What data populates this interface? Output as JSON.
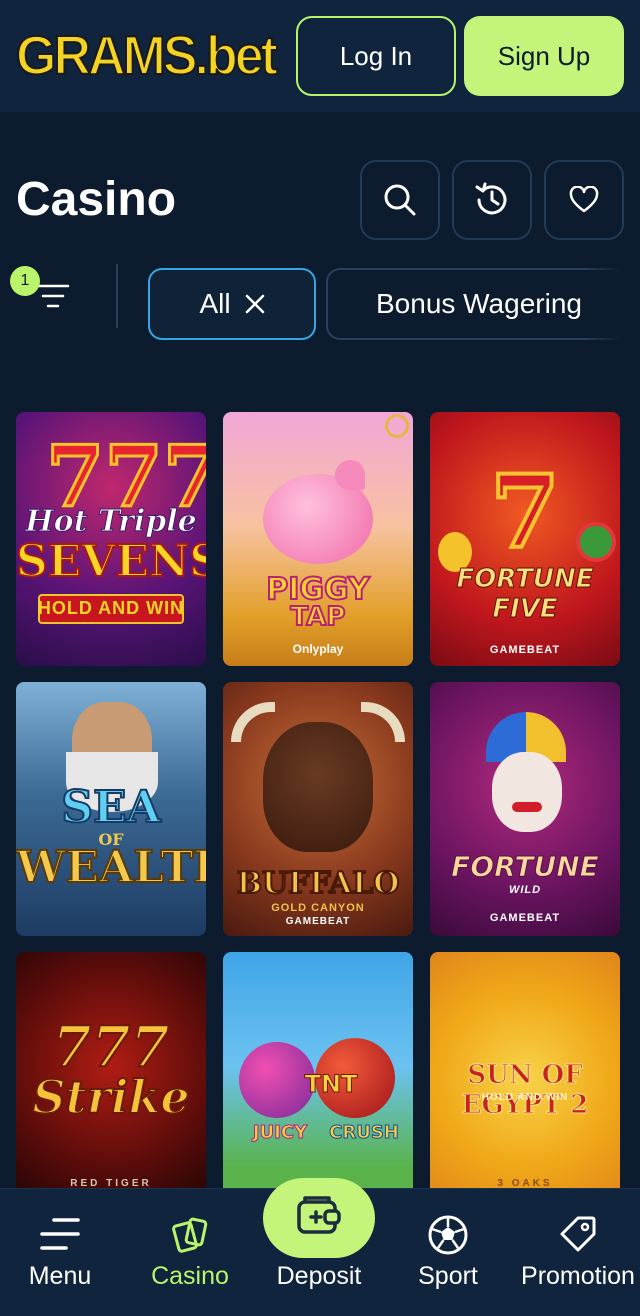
{
  "header": {
    "logo_text": "GRAMS.bet",
    "login_label": "Log In",
    "signup_label": "Sign Up"
  },
  "page": {
    "title": "Casino"
  },
  "filters": {
    "badge_count": "1",
    "chips": [
      {
        "label": "All",
        "active": true
      },
      {
        "label": "Bonus Wagering",
        "active": false
      }
    ]
  },
  "games": [
    {
      "title_line1": "Hot Triple",
      "title_line2": "SEVENS",
      "subtitle": "HOLD AND WIN",
      "provider": ""
    },
    {
      "title_line1": "PIGGY",
      "title_line2": "TAP",
      "subtitle": "",
      "provider": "Onlyplay"
    },
    {
      "title_line1": "FORTUNE",
      "title_line2": "FIVE",
      "subtitle": "",
      "provider": "GAMEBEAT"
    },
    {
      "title_line1": "SEA",
      "title_line2": "WEALTH",
      "subtitle": "OF",
      "provider": ""
    },
    {
      "title_line1": "BUFFALO",
      "title_line2": "",
      "subtitle": "GOLD CANYON",
      "provider": "GAMEBEAT"
    },
    {
      "title_line1": "FORTUNE",
      "title_line2": "WILD",
      "subtitle": "",
      "provider": "GAMEBEAT"
    },
    {
      "title_line1": "777",
      "title_line2": "Strike",
      "subtitle": "",
      "provider": "RED TIGER"
    },
    {
      "title_line1": "JUICY",
      "title_line2": "CRUSH",
      "subtitle": "TNT",
      "provider": ""
    },
    {
      "title_line1": "SUN OF EGYPT 2",
      "title_line2": "",
      "subtitle": "HOLD AND WIN",
      "provider": "3 OAKS"
    }
  ],
  "bottom_nav": {
    "items": [
      {
        "label": "Menu",
        "icon": "menu-icon",
        "active": false
      },
      {
        "label": "Casino",
        "icon": "cards-icon",
        "active": true
      },
      {
        "label": "Deposit",
        "icon": "wallet-plus-icon",
        "active": false
      },
      {
        "label": "Sport",
        "icon": "soccer-ball-icon",
        "active": false
      },
      {
        "label": "Promotion",
        "icon": "tag-icon",
        "active": false
      }
    ]
  },
  "colors": {
    "background": "#0c1b2e",
    "header": "#11243d",
    "accent": "#c4f57a",
    "chip_active_border": "#37a6e0",
    "logo": "#f5d323"
  }
}
